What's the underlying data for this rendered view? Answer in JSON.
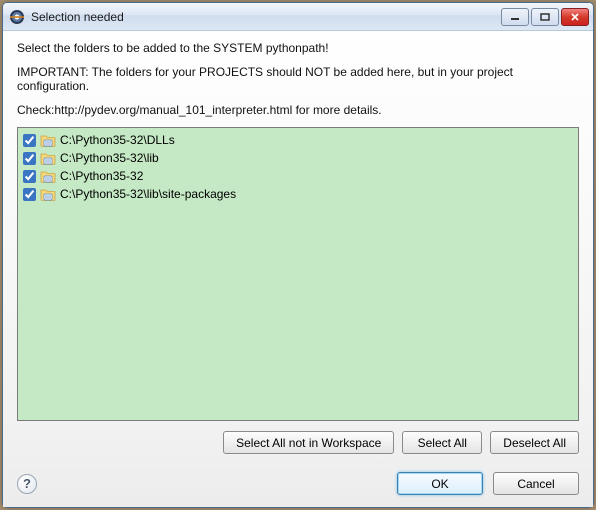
{
  "window": {
    "title": "Selection needed"
  },
  "messages": {
    "line1": "Select the folders to be added to the SYSTEM pythonpath!",
    "line2": "IMPORTANT: The folders for your PROJECTS should NOT be added here, but in your project configuration.",
    "line3": "Check:http://pydev.org/manual_101_interpreter.html for more details."
  },
  "folders": [
    {
      "checked": true,
      "path": "C:\\Python35-32\\DLLs"
    },
    {
      "checked": true,
      "path": "C:\\Python35-32\\lib"
    },
    {
      "checked": true,
      "path": "C:\\Python35-32"
    },
    {
      "checked": true,
      "path": "C:\\Python35-32\\lib\\site-packages"
    }
  ],
  "buttons": {
    "select_all_not_in_workspace": "Select All not in Workspace",
    "select_all": "Select All",
    "deselect_all": "Deselect All",
    "ok": "OK",
    "cancel": "Cancel"
  },
  "help_tooltip": "?"
}
